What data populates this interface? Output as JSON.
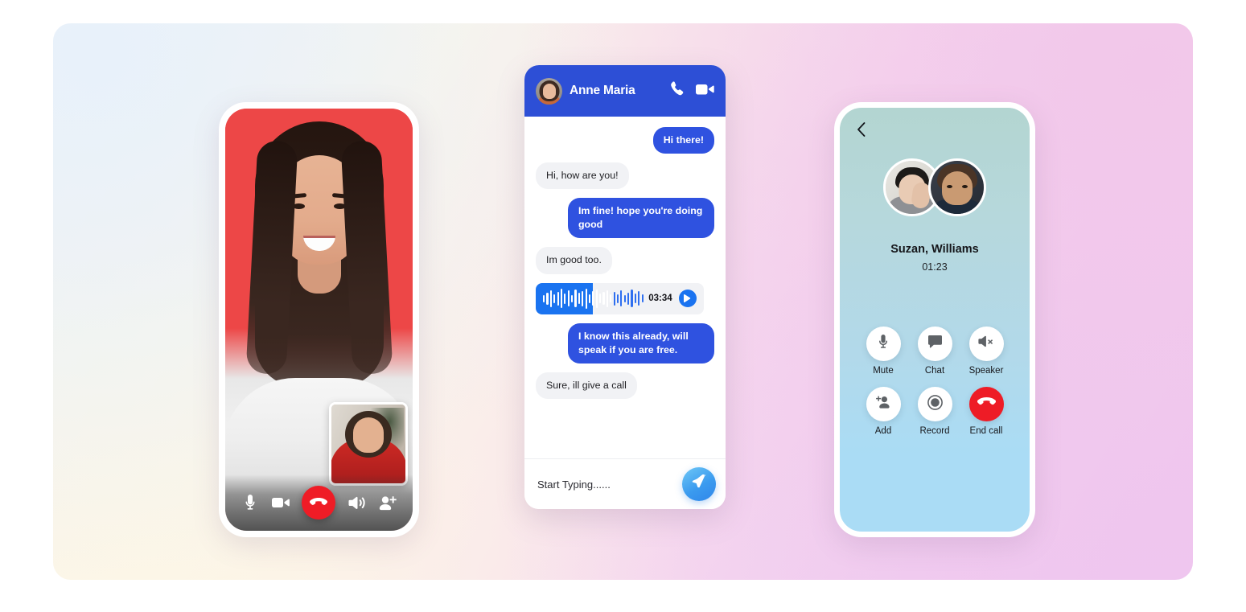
{
  "background": {
    "gradient_from": "#eef4fb",
    "gradient_mid": "#fbf5e9",
    "gradient_to": "#eec6f0"
  },
  "video_call_phone": {
    "name": "video-call-screen",
    "background_color": "#ed4747",
    "pip_label": "self-view",
    "controls": [
      {
        "id": "mic",
        "icon": "microphone-icon",
        "label": "Microphone"
      },
      {
        "id": "video",
        "icon": "video-camera-icon",
        "label": "Camera"
      },
      {
        "id": "end",
        "icon": "phone-hangup-icon",
        "label": "End call",
        "color": "#ef1c26"
      },
      {
        "id": "speaker",
        "icon": "speaker-icon",
        "label": "Speaker"
      },
      {
        "id": "add",
        "icon": "add-person-icon",
        "label": "Add person"
      }
    ]
  },
  "chat_phone": {
    "header": {
      "contact_name": "Anne Maria",
      "avatar": "contact-avatar",
      "call_icon": "phone-icon",
      "video_icon": "video-camera-icon",
      "background_color": "#2d4fd6"
    },
    "messages": [
      {
        "side": "out",
        "text": "Hi there!"
      },
      {
        "side": "in",
        "text": "Hi, how are you!"
      },
      {
        "side": "out",
        "text": "Im fine! hope you're doing good"
      },
      {
        "side": "in",
        "text": "Im good too."
      },
      {
        "side": "voice",
        "duration": "03:34",
        "progress_percent": 52
      },
      {
        "side": "out",
        "text": "I know this already, will speak if you are free."
      },
      {
        "side": "in",
        "text": "Sure, ill give a call"
      }
    ],
    "input": {
      "placeholder": "Start Typing......",
      "send_icon": "send-paper-plane-icon"
    }
  },
  "audio_call_phone": {
    "back_icon": "chevron-left-icon",
    "participants": "Suzan, Williams",
    "timer": "01:23",
    "avatars": [
      "participant-avatar-1",
      "participant-avatar-2"
    ],
    "controls": [
      {
        "id": "mute",
        "label": "Mute",
        "icon": "microphone-icon"
      },
      {
        "id": "chat",
        "label": "Chat",
        "icon": "chat-bubble-icon"
      },
      {
        "id": "speaker",
        "label": "Speaker",
        "icon": "speaker-mute-icon"
      },
      {
        "id": "add",
        "label": "Add",
        "icon": "add-person-icon"
      },
      {
        "id": "record",
        "label": "Record",
        "icon": "record-circle-icon"
      },
      {
        "id": "endcall",
        "label": "End call",
        "icon": "phone-hangup-icon",
        "color": "#ee1c26"
      }
    ]
  }
}
